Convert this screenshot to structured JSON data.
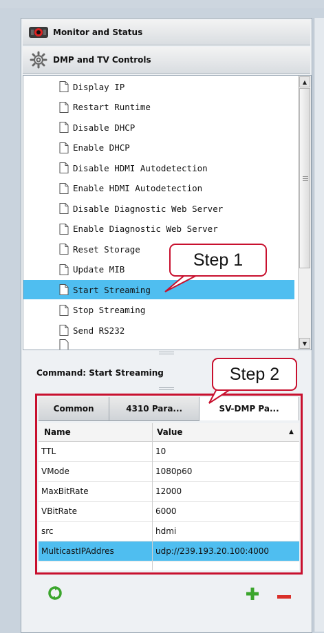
{
  "accordion": {
    "monitor_label": "Monitor and Status",
    "dmp_label": "DMP and TV Controls"
  },
  "commands": [
    {
      "label": "Display IP",
      "selected": false
    },
    {
      "label": "Restart Runtime",
      "selected": false
    },
    {
      "label": "Disable DHCP",
      "selected": false
    },
    {
      "label": "Enable DHCP",
      "selected": false
    },
    {
      "label": "Disable HDMI Autodetection",
      "selected": false
    },
    {
      "label": "Enable HDMI Autodetection",
      "selected": false
    },
    {
      "label": "Disable Diagnostic Web Server",
      "selected": false
    },
    {
      "label": "Enable Diagnostic Web Server",
      "selected": false
    },
    {
      "label": "Reset Storage",
      "selected": false
    },
    {
      "label": "Update MIB",
      "selected": false
    },
    {
      "label": "Start Streaming",
      "selected": true
    },
    {
      "label": "Stop Streaming",
      "selected": false
    },
    {
      "label": "Send RS232",
      "selected": false
    }
  ],
  "command_section_title": "Command: Start Streaming",
  "tabs": [
    {
      "label": "Common",
      "active": false
    },
    {
      "label": "4310 Para...",
      "active": false
    },
    {
      "label": "SV-DMP Pa...",
      "active": true
    }
  ],
  "params": {
    "name_header": "Name",
    "value_header": "Value",
    "sort_indicator": "▲",
    "rows": [
      {
        "name": "TTL",
        "value": "10",
        "selected": false
      },
      {
        "name": "VMode",
        "value": "1080p60",
        "selected": false
      },
      {
        "name": "MaxBitRate",
        "value": "12000",
        "selected": false
      },
      {
        "name": "VBitRate",
        "value": "6000",
        "selected": false
      },
      {
        "name": "src",
        "value": "hdmi",
        "selected": false
      },
      {
        "name": "MulticastIPAddres",
        "value": "udp://239.193.20.100:4000",
        "selected": true
      }
    ]
  },
  "callouts": {
    "step1": "Step 1",
    "step2": "Step 2"
  },
  "colors": {
    "selection": "#4fbef0",
    "highlight_red": "#c8102e",
    "add_green": "#3aa52c",
    "remove_red": "#d9302a"
  },
  "icons": {
    "monitor": "monitor-icon",
    "gear": "gear-icon",
    "document": "document-icon",
    "refresh": "refresh-icon",
    "add": "add-icon",
    "remove": "remove-icon"
  }
}
